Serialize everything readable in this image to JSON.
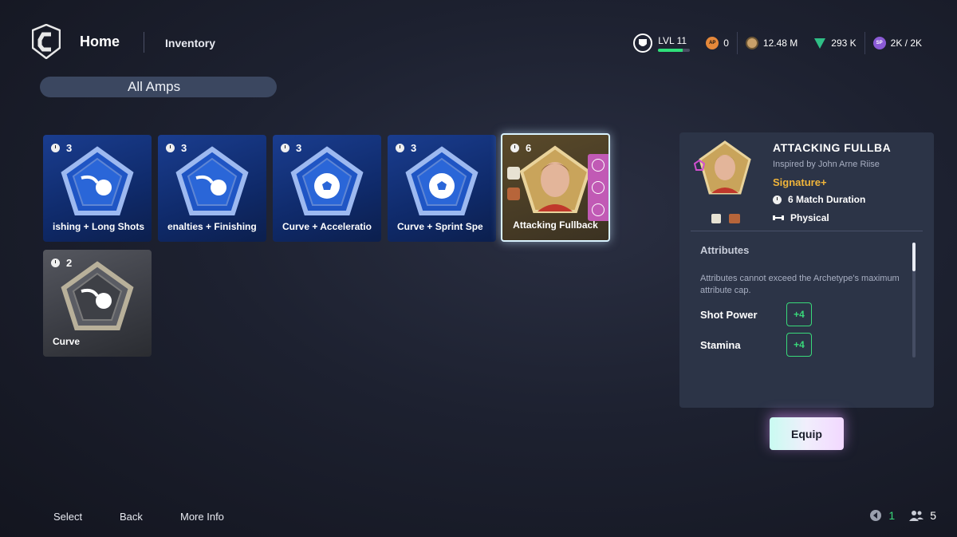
{
  "header": {
    "home_label": "Home",
    "inventory_label": "Inventory",
    "stats": {
      "level_label": "LVL 11",
      "level_progress": 0.78,
      "ap_icon_text": "AP",
      "ap_value": "0",
      "coins_value": "12.48 M",
      "points_value": "293 K",
      "sp_icon_text": "SP",
      "sp_value": "2K / 2K"
    }
  },
  "filter": {
    "label": "All Amps"
  },
  "cards": [
    {
      "count": "3",
      "label": "ishing + Long Shots",
      "style": "blue",
      "icon": "fireball-icon"
    },
    {
      "count": "3",
      "label": "enalties + Finishing",
      "style": "blue",
      "icon": "fireball-icon"
    },
    {
      "count": "3",
      "label": "Curve + Acceleratio",
      "style": "blue",
      "icon": "soccer-ball-icon"
    },
    {
      "count": "3",
      "label": "Curve + Sprint Spe",
      "style": "blue",
      "icon": "soccer-ball-icon"
    },
    {
      "count": "6",
      "label": "Attacking Fullback",
      "style": "gold",
      "icon": "player-portrait"
    },
    {
      "count": "2",
      "label": "Curve",
      "style": "gray",
      "icon": "fireball-icon"
    }
  ],
  "detail": {
    "title": "ATTACKING FULLBA",
    "subtitle": "Inspired by John Arne Riise",
    "rarity": "Signature+",
    "duration": "6 Match Duration",
    "type": "Physical",
    "attributes_title": "Attributes",
    "attributes_note": "Attributes cannot exceed the Archetype's maximum attribute cap.",
    "attributes": [
      {
        "name": "Shot Power",
        "value": "+4"
      },
      {
        "name": "Stamina",
        "value": "+4"
      }
    ]
  },
  "equip_label": "Equip",
  "footer": {
    "select": "Select",
    "back": "Back",
    "more_info": "More Info",
    "notifications": "1",
    "party_count": "5"
  },
  "colors": {
    "accent_green": "#39d97a",
    "rarity_gold": "#f1b53a",
    "panel_bg": "#2c3447"
  }
}
